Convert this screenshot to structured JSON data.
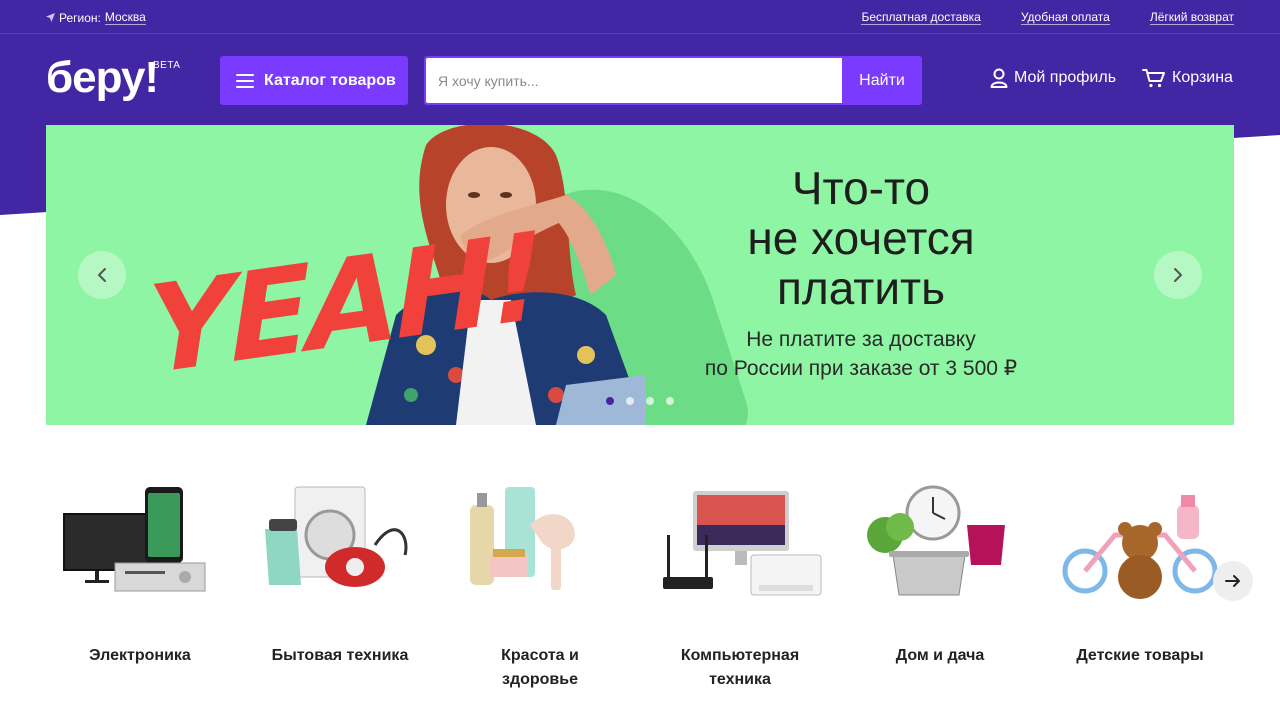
{
  "topbar": {
    "region_label": "Регион:",
    "region_city": "Москва",
    "links": [
      "Бесплатная доставка",
      "Удобная оплата",
      "Лёгкий возврат"
    ]
  },
  "header": {
    "logo": "беру!",
    "beta": "BETA",
    "catalog_label": "Каталог товаров",
    "search_placeholder": "Я хочу купить...",
    "search_button": "Найти",
    "profile_label": "Мой профиль",
    "cart_label": "Корзина"
  },
  "banner": {
    "graphic_text": "YEAH!",
    "title_line1": "Что-то",
    "title_line2": "не хочется",
    "title_line3": "платить",
    "subtitle_line1": "Не платите за доставку",
    "subtitle_line2": "по России при заказе от 3 500 ₽",
    "slides_count": 4,
    "active_slide": 1
  },
  "categories": [
    {
      "line1": "Электроника",
      "line2": "",
      "icon": "electronics-icon"
    },
    {
      "line1": "Бытовая техника",
      "line2": "",
      "icon": "appliances-icon"
    },
    {
      "line1": "Красота и",
      "line2": "здоровье",
      "icon": "beauty-icon"
    },
    {
      "line1": "Компьютерная",
      "line2": "техника",
      "icon": "computer-icon"
    },
    {
      "line1": "Дом и дача",
      "line2": "",
      "icon": "home-icon"
    },
    {
      "line1": "Детские товары",
      "line2": "",
      "icon": "kids-icon"
    }
  ],
  "colors": {
    "brand_purple": "#4326a3",
    "accent_violet": "#7a3bff",
    "banner_green": "#8ef5a4",
    "yeah_red": "#f0423a"
  }
}
